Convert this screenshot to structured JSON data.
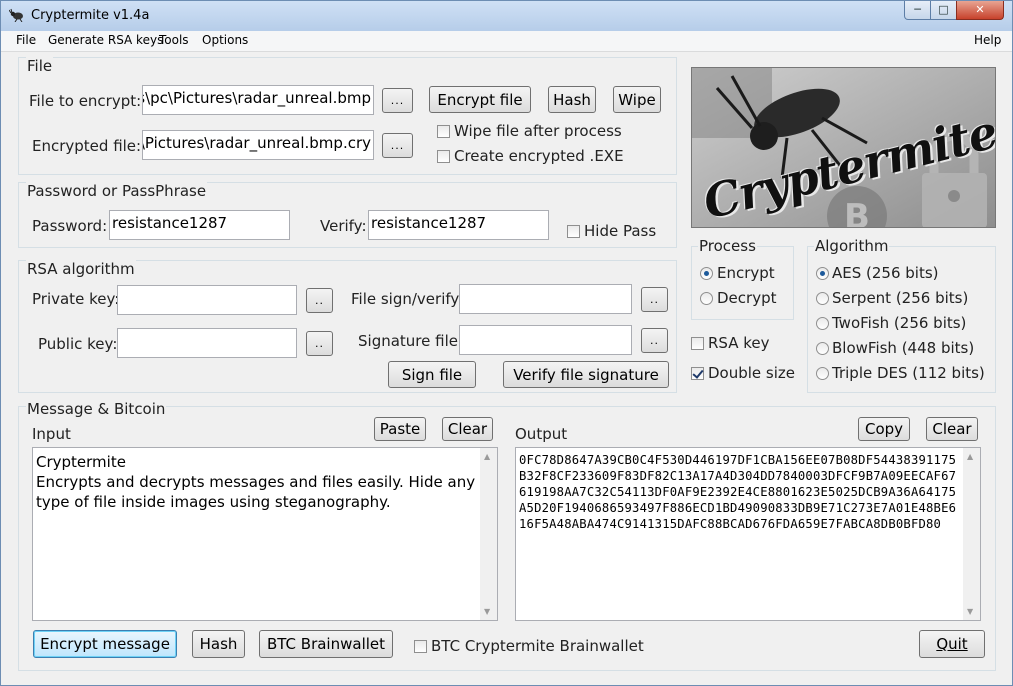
{
  "window": {
    "title": "Cryptermite v1.4a",
    "controls": {
      "minimize": "─",
      "maximize": "□",
      "close": "✕"
    }
  },
  "menu": {
    "items": [
      "File",
      "Generate RSA keys",
      "Tools",
      "Options"
    ],
    "help": "Help"
  },
  "file_group": {
    "title": "File",
    "file_to_encrypt_label": "File to encrypt:",
    "file_to_encrypt_value": "C:\\Users\\pc\\Pictures\\radar_unreal.bmp",
    "encrypted_file_label": "Encrypted file:",
    "encrypted_file_value": "C:\\Users\\pc\\Pictures\\radar_unreal.bmp.cry",
    "browse_label": "...",
    "encrypt_file_button": "Encrypt file",
    "hash_button": "Hash",
    "wipe_button": "Wipe",
    "wipe_after_label": "Wipe file after process",
    "wipe_after_checked": false,
    "create_exe_label": "Create encrypted .EXE",
    "create_exe_checked": false
  },
  "password_group": {
    "title": "Password or PassPhrase",
    "password_label": "Password:",
    "password_value": "resistance1287",
    "verify_label": "Verify:",
    "verify_value": "resistance1287",
    "hide_pass_label": "Hide Pass",
    "hide_pass_checked": false
  },
  "rsa_group": {
    "title": "RSA algorithm",
    "private_key_label": "Private key:",
    "private_key_value": "",
    "public_key_label": "Public key:",
    "public_key_value": "",
    "file_sign_label": "File sign/verify:",
    "file_sign_value": "",
    "signature_file_label": "Signature file:",
    "signature_file_value": "",
    "small_browse_label": "..",
    "sign_file_button": "Sign file",
    "verify_signature_button": "Verify file signature"
  },
  "logo": {
    "text": "Cryptermite"
  },
  "process_group": {
    "title": "Process",
    "options": [
      "Encrypt",
      "Decrypt"
    ],
    "selected": 0
  },
  "algorithm_group": {
    "title": "Algorithm",
    "options": [
      "AES (256 bits)",
      "Serpent (256 bits)",
      "TwoFish (256 bits)",
      "BlowFish (448 bits)",
      "Triple DES (112 bits)"
    ],
    "selected": 0
  },
  "options": {
    "rsa_key_label": "RSA key",
    "rsa_key_checked": false,
    "double_size_label": "Double size",
    "double_size_checked": true
  },
  "message_group": {
    "title": "Message & Bitcoin",
    "input_label": "Input",
    "paste_button": "Paste",
    "clear_button": "Clear",
    "input_text": "Cryptermite\nEncrypts and decrypts messages and files easily. Hide any type of file inside images using steganography.",
    "output_label": "Output",
    "copy_button": "Copy",
    "output_clear_button": "Clear",
    "output_text": "0FC78D8647A39CB0C4F530D446197DF1CBA156EE07B08DF54438391175B32F8CF233609F83DF82C13A17A4D304DD7840003DFCF9B7A09EECAF67619198AA7C32C54113DF0AF9E2392E4CE8801623E5025DCB9A36A64175A5D20F1940686593497F886ECD1BD49090833DB9E71C273E7A01E48BE616F5A48ABA474C9141315DAFC88BCAD676FDA659E7FABCA8DB0BFD80",
    "encrypt_message_button": "Encrypt message",
    "hash_button": "Hash",
    "btc_brainwallet_button": "BTC Brainwallet",
    "btc_cryptermite_label": "BTC Cryptermite Brainwallet",
    "btc_cryptermite_checked": false,
    "quit_button": "Quit"
  }
}
